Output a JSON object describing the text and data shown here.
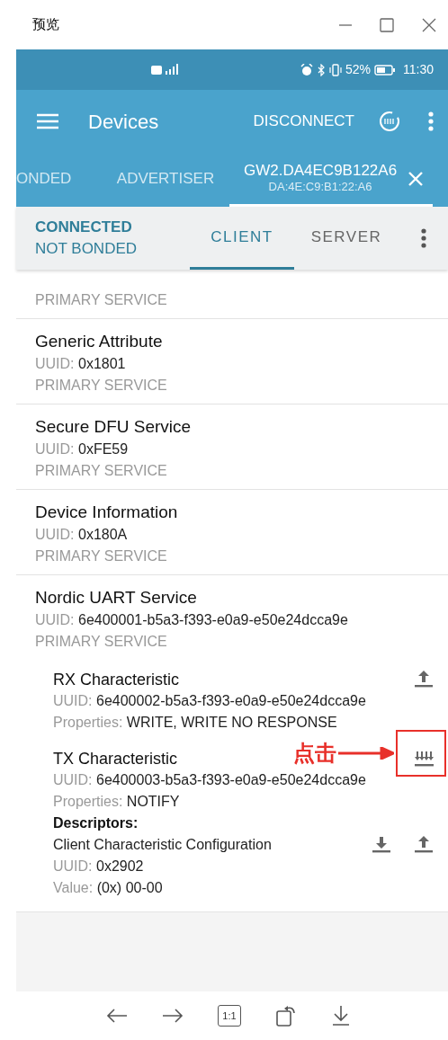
{
  "window": {
    "title": "预览"
  },
  "status_bar": {
    "battery": "52%",
    "time": "11:30"
  },
  "toolbar": {
    "title": "Devices",
    "action": "DISCONNECT"
  },
  "device_tabs": [
    {
      "label": "ONDED",
      "selected": false
    },
    {
      "label": "ADVERTISER",
      "selected": false
    },
    {
      "label": "GW2.DA4EC9B122A6",
      "address": "DA:4E:C9:B1:22:A6",
      "selected": true
    }
  ],
  "connection": {
    "state": "CONNECTED",
    "bond": "NOT BONDED"
  },
  "client_tabs": [
    {
      "label": "CLIENT",
      "selected": true
    },
    {
      "label": "SERVER",
      "selected": false
    }
  ],
  "services": [
    {
      "type": "PRIMARY SERVICE"
    },
    {
      "name": "Generic Attribute",
      "uuid_label": "UUID:",
      "uuid": "0x1801",
      "type": "PRIMARY SERVICE"
    },
    {
      "name": "Secure DFU Service",
      "uuid_label": "UUID:",
      "uuid": "0xFE59",
      "type": "PRIMARY SERVICE"
    },
    {
      "name": "Device Information",
      "uuid_label": "UUID:",
      "uuid": "0x180A",
      "type": "PRIMARY SERVICE"
    },
    {
      "name": "Nordic UART Service",
      "uuid_label": "UUID:",
      "uuid": "6e400001-b5a3-f393-e0a9-e50e24dcca9e",
      "type": "PRIMARY SERVICE",
      "characteristics": [
        {
          "name": "RX Characteristic",
          "uuid_label": "UUID:",
          "uuid": "6e400002-b5a3-f393-e0a9-e50e24dcca9e",
          "properties_label": "Properties:",
          "properties": "WRITE, WRITE NO RESPONSE",
          "actions": [
            {
              "kind": "write"
            }
          ]
        },
        {
          "name": "TX Characteristic",
          "uuid_label": "UUID:",
          "uuid": "6e400003-b5a3-f393-e0a9-e50e24dcca9e",
          "properties_label": "Properties:",
          "properties": "NOTIFY",
          "actions": [
            {
              "kind": "notify"
            }
          ],
          "annotation": "点击",
          "descriptors_heading": "Descriptors:",
          "descriptors": [
            {
              "name": "Client Characteristic Configuration",
              "uuid_label": "UUID:",
              "uuid": "0x2902",
              "value_label": "Value:",
              "value": "(0x) 00-00",
              "actions": [
                {
                  "kind": "read"
                },
                {
                  "kind": "write"
                }
              ]
            }
          ]
        }
      ]
    }
  ],
  "viewer_toolbar": {
    "actual_size": "1:1"
  }
}
